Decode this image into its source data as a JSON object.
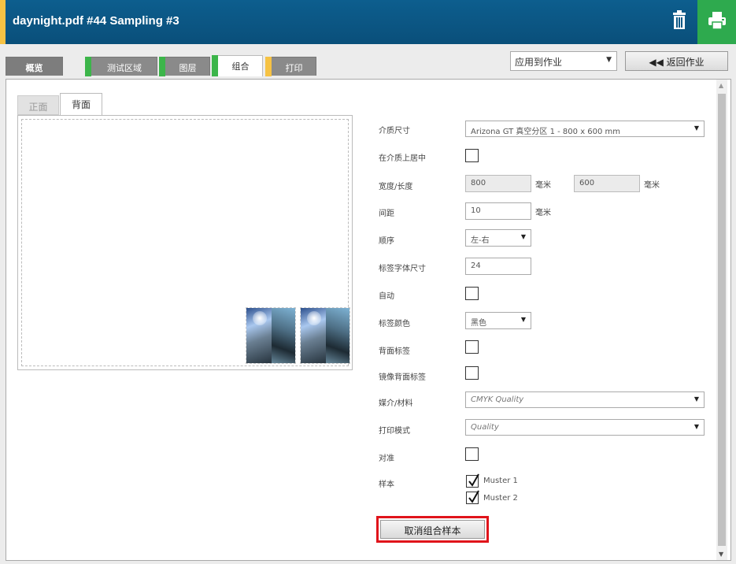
{
  "header": {
    "title": "daynight.pdf #44 Sampling #3"
  },
  "tabs": [
    {
      "label": "概览",
      "bar": ""
    },
    {
      "label": "测试区域",
      "bar": "#3cb54a"
    },
    {
      "label": "图层",
      "bar": "#3cb54a"
    },
    {
      "label": "组合",
      "bar": "#3cb54a"
    },
    {
      "label": "打印",
      "bar": "#f6c244"
    }
  ],
  "toolbar": {
    "apply_select": "应用到作业",
    "back_button": "◀◀ 返回作业"
  },
  "subtabs": {
    "front": "正面",
    "back": "背面"
  },
  "form": {
    "media_size": {
      "label": "介质尺寸",
      "value": "Arizona GT 真空分区 1 - 800 x 600 mm"
    },
    "center_on_media": {
      "label": "在介质上居中"
    },
    "width_length": {
      "label": "宽度/长度",
      "width": "800",
      "width_unit": "毫米",
      "length": "600",
      "length_unit": "毫米"
    },
    "spacing": {
      "label": "间距",
      "value": "10",
      "unit": "毫米"
    },
    "order": {
      "label": "顺序",
      "value": "左-右"
    },
    "label_font_size": {
      "label": "标签字体尺寸",
      "value": "24"
    },
    "auto": {
      "label": "自动"
    },
    "label_color": {
      "label": "标签颜色",
      "value": "黑色"
    },
    "back_label": {
      "label": "背面标签"
    },
    "mirror_back_label": {
      "label": "镜像背面标签"
    },
    "media_material": {
      "label": "媒介/材料",
      "value": "CMYK Quality"
    },
    "print_mode": {
      "label": "打印模式",
      "value": "Quality"
    },
    "align": {
      "label": "对准"
    },
    "samples": {
      "label": "样本",
      "items": [
        "Muster 1",
        "Muster 2"
      ]
    }
  },
  "ungroup_button": "取消组合样本"
}
